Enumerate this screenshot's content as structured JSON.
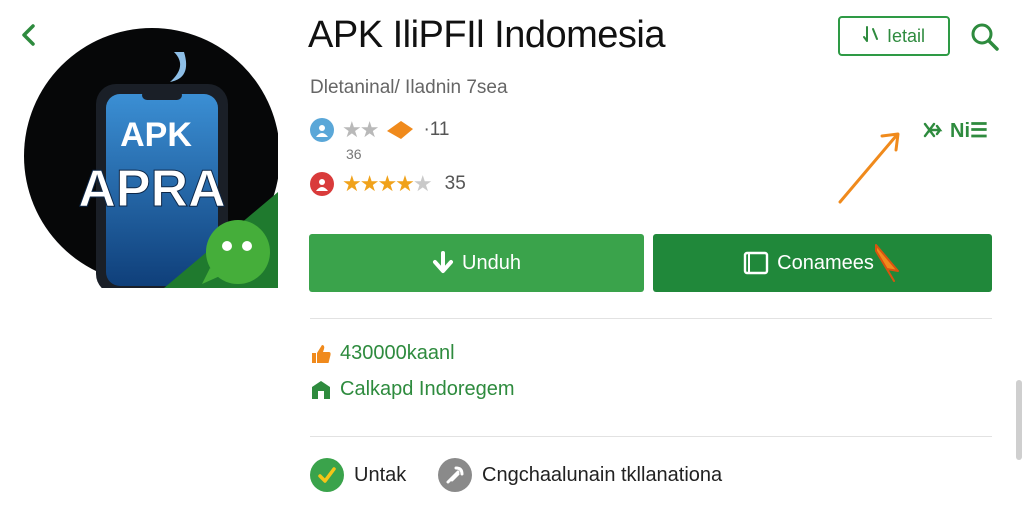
{
  "app": {
    "title": "APK IliPFIl Indomesia",
    "subtitle": "Dletaninal/ Iladnin 7sea",
    "icon_text_line1": "APK",
    "icon_text_line2": "APRA"
  },
  "header": {
    "detail_label": "Ietail"
  },
  "share": {
    "label": "Ni☰"
  },
  "ratings": [
    {
      "stars": "★★★",
      "count": "·11",
      "sub": "36",
      "badge_color": "#5aa7d8"
    },
    {
      "stars": "★★★★★",
      "count": "35",
      "sub": "",
      "badge_color": "#d93b3b"
    }
  ],
  "actions": {
    "download_label": "Unduh",
    "open_label": "Conamees"
  },
  "info": {
    "downloads": "430000kaanl",
    "category": "Calkapd Indoregem"
  },
  "bottom": [
    {
      "label": "Untak"
    },
    {
      "label": "Cngchaalunain tkllanationa"
    }
  ],
  "colors": {
    "primary_green": "#3aa34b",
    "dark_green": "#20883a",
    "accent_orange": "#f08a1c",
    "star_gold": "#f0a21b"
  },
  "icons": [
    "back-arrow-icon",
    "search-icon",
    "share-icon",
    "download-icon",
    "open-window-icon",
    "thumbs-up-icon",
    "store-icon",
    "check-icon",
    "tools-icon"
  ]
}
